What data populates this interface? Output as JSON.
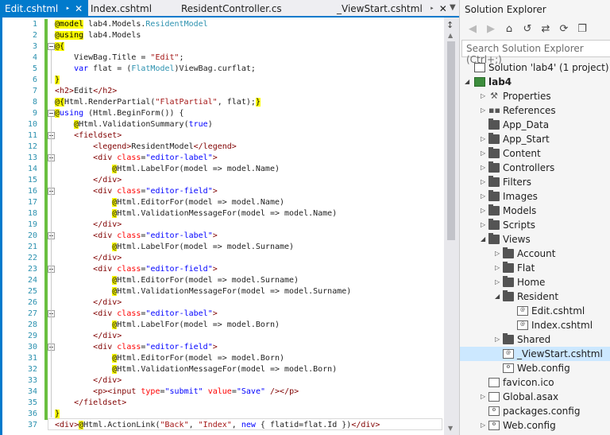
{
  "tabs": [
    {
      "label": "Edit.cshtml",
      "active": true,
      "pin": "‣",
      "close": "✕"
    },
    {
      "label": "Index.cshtml",
      "active": false
    },
    {
      "label": "ResidentController.cs",
      "active": false
    },
    {
      "label": "_ViewStart.cshtml",
      "active": false,
      "pin": "‣",
      "close": "✕"
    }
  ],
  "editor": {
    "line_numbers": [
      "1",
      "2",
      "3",
      "4",
      "5",
      "6",
      "7",
      "8",
      "9",
      "10",
      "11",
      "12",
      "13",
      "14",
      "15",
      "16",
      "17",
      "18",
      "19",
      "20",
      "21",
      "22",
      "23",
      "24",
      "25",
      "26",
      "27",
      "28",
      "29",
      "30",
      "31",
      "32",
      "33",
      "34",
      "35",
      "36",
      "37"
    ],
    "lines": [
      [
        {
          "t": "@model",
          "c": "rz"
        },
        {
          "t": " lab4.Models.",
          "c": ""
        },
        {
          "t": "ResidentModel",
          "c": "tp"
        }
      ],
      [
        {
          "t": "@using",
          "c": "rz"
        },
        {
          "t": " lab4.Models",
          "c": ""
        }
      ],
      [
        {
          "t": "@{",
          "c": "rz"
        }
      ],
      [
        {
          "t": "    ViewBag.Title = ",
          "c": ""
        },
        {
          "t": "\"Edit\"",
          "c": "st"
        },
        {
          "t": ";",
          "c": ""
        }
      ],
      [
        {
          "t": "    ",
          "c": ""
        },
        {
          "t": "var",
          "c": "kw"
        },
        {
          "t": " flat = (",
          "c": ""
        },
        {
          "t": "FlatModel",
          "c": "tp"
        },
        {
          "t": ")ViewBag.curflat;",
          "c": ""
        }
      ],
      [
        {
          "t": "}",
          "c": "rz"
        }
      ],
      [
        {
          "t": "<h2>",
          "c": "tg"
        },
        {
          "t": "Edit",
          "c": ""
        },
        {
          "t": "</h2>",
          "c": "tg"
        }
      ],
      [
        {
          "t": "@{",
          "c": "rz"
        },
        {
          "t": "Html.RenderPartial(",
          "c": ""
        },
        {
          "t": "\"FlatPartial\"",
          "c": "st"
        },
        {
          "t": ", flat);",
          "c": ""
        },
        {
          "t": "}",
          "c": "rz"
        }
      ],
      [
        {
          "t": "@",
          "c": "rz"
        },
        {
          "t": "using",
          "c": "kw"
        },
        {
          "t": " (Html.BeginForm()) {",
          "c": ""
        }
      ],
      [
        {
          "t": "    ",
          "c": ""
        },
        {
          "t": "@",
          "c": "rz"
        },
        {
          "t": "Html.ValidationSummary(",
          "c": ""
        },
        {
          "t": "true",
          "c": "kw"
        },
        {
          "t": ")",
          "c": ""
        }
      ],
      [
        {
          "t": "    ",
          "c": ""
        },
        {
          "t": "<fieldset>",
          "c": "tg"
        }
      ],
      [
        {
          "t": "        ",
          "c": ""
        },
        {
          "t": "<legend>",
          "c": "tg"
        },
        {
          "t": "ResidentModel",
          "c": ""
        },
        {
          "t": "</legend>",
          "c": "tg"
        }
      ],
      [
        {
          "t": "        ",
          "c": ""
        },
        {
          "t": "<div ",
          "c": "tg"
        },
        {
          "t": "class",
          "c": "at"
        },
        {
          "t": "=",
          "c": ""
        },
        {
          "t": "\"editor-label\"",
          "c": "av"
        },
        {
          "t": ">",
          "c": "tg"
        }
      ],
      [
        {
          "t": "            ",
          "c": ""
        },
        {
          "t": "@",
          "c": "rz"
        },
        {
          "t": "Html.LabelFor(model => model.Name)",
          "c": ""
        }
      ],
      [
        {
          "t": "        ",
          "c": ""
        },
        {
          "t": "</div>",
          "c": "tg"
        }
      ],
      [
        {
          "t": "        ",
          "c": ""
        },
        {
          "t": "<div ",
          "c": "tg"
        },
        {
          "t": "class",
          "c": "at"
        },
        {
          "t": "=",
          "c": ""
        },
        {
          "t": "\"editor-field\"",
          "c": "av"
        },
        {
          "t": ">",
          "c": "tg"
        }
      ],
      [
        {
          "t": "            ",
          "c": ""
        },
        {
          "t": "@",
          "c": "rz"
        },
        {
          "t": "Html.EditorFor(model => model.Name)",
          "c": ""
        }
      ],
      [
        {
          "t": "            ",
          "c": ""
        },
        {
          "t": "@",
          "c": "rz"
        },
        {
          "t": "Html.ValidationMessageFor(model => model.Name)",
          "c": ""
        }
      ],
      [
        {
          "t": "        ",
          "c": ""
        },
        {
          "t": "</div>",
          "c": "tg"
        }
      ],
      [
        {
          "t": "        ",
          "c": ""
        },
        {
          "t": "<div ",
          "c": "tg"
        },
        {
          "t": "class",
          "c": "at"
        },
        {
          "t": "=",
          "c": ""
        },
        {
          "t": "\"editor-label\"",
          "c": "av"
        },
        {
          "t": ">",
          "c": "tg"
        }
      ],
      [
        {
          "t": "            ",
          "c": ""
        },
        {
          "t": "@",
          "c": "rz"
        },
        {
          "t": "Html.LabelFor(model => model.Surname)",
          "c": ""
        }
      ],
      [
        {
          "t": "        ",
          "c": ""
        },
        {
          "t": "</div>",
          "c": "tg"
        }
      ],
      [
        {
          "t": "        ",
          "c": ""
        },
        {
          "t": "<div ",
          "c": "tg"
        },
        {
          "t": "class",
          "c": "at"
        },
        {
          "t": "=",
          "c": ""
        },
        {
          "t": "\"editor-field\"",
          "c": "av"
        },
        {
          "t": ">",
          "c": "tg"
        }
      ],
      [
        {
          "t": "            ",
          "c": ""
        },
        {
          "t": "@",
          "c": "rz"
        },
        {
          "t": "Html.EditorFor(model => model.Surname)",
          "c": ""
        }
      ],
      [
        {
          "t": "            ",
          "c": ""
        },
        {
          "t": "@",
          "c": "rz"
        },
        {
          "t": "Html.ValidationMessageFor(model => model.Surname)",
          "c": ""
        }
      ],
      [
        {
          "t": "        ",
          "c": ""
        },
        {
          "t": "</div>",
          "c": "tg"
        }
      ],
      [
        {
          "t": "        ",
          "c": ""
        },
        {
          "t": "<div ",
          "c": "tg"
        },
        {
          "t": "class",
          "c": "at"
        },
        {
          "t": "=",
          "c": ""
        },
        {
          "t": "\"editor-label\"",
          "c": "av"
        },
        {
          "t": ">",
          "c": "tg"
        }
      ],
      [
        {
          "t": "            ",
          "c": ""
        },
        {
          "t": "@",
          "c": "rz"
        },
        {
          "t": "Html.LabelFor(model => model.Born)",
          "c": ""
        }
      ],
      [
        {
          "t": "        ",
          "c": ""
        },
        {
          "t": "</div>",
          "c": "tg"
        }
      ],
      [
        {
          "t": "        ",
          "c": ""
        },
        {
          "t": "<div ",
          "c": "tg"
        },
        {
          "t": "class",
          "c": "at"
        },
        {
          "t": "=",
          "c": ""
        },
        {
          "t": "\"editor-field\"",
          "c": "av"
        },
        {
          "t": ">",
          "c": "tg"
        }
      ],
      [
        {
          "t": "            ",
          "c": ""
        },
        {
          "t": "@",
          "c": "rz"
        },
        {
          "t": "Html.EditorFor(model => model.Born)",
          "c": ""
        }
      ],
      [
        {
          "t": "            ",
          "c": ""
        },
        {
          "t": "@",
          "c": "rz"
        },
        {
          "t": "Html.ValidationMessageFor(model => model.Born)",
          "c": ""
        }
      ],
      [
        {
          "t": "        ",
          "c": ""
        },
        {
          "t": "</div>",
          "c": "tg"
        }
      ],
      [
        {
          "t": "        ",
          "c": ""
        },
        {
          "t": "<p><input ",
          "c": "tg"
        },
        {
          "t": "type",
          "c": "at"
        },
        {
          "t": "=",
          "c": ""
        },
        {
          "t": "\"submit\"",
          "c": "av"
        },
        {
          "t": " ",
          "c": ""
        },
        {
          "t": "value",
          "c": "at"
        },
        {
          "t": "=",
          "c": ""
        },
        {
          "t": "\"Save\"",
          "c": "av"
        },
        {
          "t": " /></p>",
          "c": "tg"
        }
      ],
      [
        {
          "t": "    ",
          "c": ""
        },
        {
          "t": "</fieldset>",
          "c": "tg"
        }
      ],
      [
        {
          "t": "}",
          "c": "rz"
        }
      ],
      [
        {
          "t": "<div>",
          "c": "tg"
        },
        {
          "t": "@",
          "c": "rz"
        },
        {
          "t": "Html.ActionLink(",
          "c": ""
        },
        {
          "t": "\"Back\"",
          "c": "st"
        },
        {
          "t": ", ",
          "c": ""
        },
        {
          "t": "\"Index\"",
          "c": "st"
        },
        {
          "t": ", ",
          "c": ""
        },
        {
          "t": "new",
          "c": "kw"
        },
        {
          "t": " { flatid=flat.Id }",
          "c": ""
        },
        {
          "t": ")",
          "c": ""
        },
        {
          "t": "</div>",
          "c": "tg"
        }
      ]
    ]
  },
  "scrollbar": {
    "split_icon": "↕",
    "up_icon": "▲",
    "down_icon": "▼"
  },
  "solution_explorer": {
    "title": "Solution Explorer",
    "toolbar_icons": [
      "◀",
      "▶",
      "⌂",
      "↺",
      "⇄",
      "⟳",
      "❐"
    ],
    "search_placeholder": "Search Solution Explorer (Ctrl+;)",
    "tree": [
      {
        "label": "Solution 'lab4' (1 project)",
        "level": 0,
        "arrow": "",
        "icon": "solution"
      },
      {
        "label": "lab4",
        "level": 0,
        "arrow": "◢",
        "icon": "project",
        "bold": true
      },
      {
        "label": "Properties",
        "level": 1,
        "arrow": "▷",
        "icon": "props"
      },
      {
        "label": "References",
        "level": 1,
        "arrow": "▷",
        "icon": "refs"
      },
      {
        "label": "App_Data",
        "level": 1,
        "arrow": "",
        "icon": "folder"
      },
      {
        "label": "App_Start",
        "level": 1,
        "arrow": "▷",
        "icon": "folder"
      },
      {
        "label": "Content",
        "level": 1,
        "arrow": "▷",
        "icon": "folder"
      },
      {
        "label": "Controllers",
        "level": 1,
        "arrow": "▷",
        "icon": "folder"
      },
      {
        "label": "Filters",
        "level": 1,
        "arrow": "▷",
        "icon": "folder"
      },
      {
        "label": "Images",
        "level": 1,
        "arrow": "▷",
        "icon": "folder"
      },
      {
        "label": "Models",
        "level": 1,
        "arrow": "▷",
        "icon": "folder"
      },
      {
        "label": "Scripts",
        "level": 1,
        "arrow": "▷",
        "icon": "folder"
      },
      {
        "label": "Views",
        "level": 1,
        "arrow": "◢",
        "icon": "folder"
      },
      {
        "label": "Account",
        "level": 2,
        "arrow": "▷",
        "icon": "folder"
      },
      {
        "label": "Flat",
        "level": 2,
        "arrow": "▷",
        "icon": "folder"
      },
      {
        "label": "Home",
        "level": 2,
        "arrow": "▷",
        "icon": "folder"
      },
      {
        "label": "Resident",
        "level": 2,
        "arrow": "◢",
        "icon": "folder"
      },
      {
        "label": "Edit.cshtml",
        "level": 3,
        "arrow": "",
        "icon": "cshtml"
      },
      {
        "label": "Index.cshtml",
        "level": 3,
        "arrow": "",
        "icon": "cshtml"
      },
      {
        "label": "Shared",
        "level": 2,
        "arrow": "▷",
        "icon": "folder"
      },
      {
        "label": "_ViewStart.cshtml",
        "level": 2,
        "arrow": "",
        "icon": "cshtml",
        "selected": true
      },
      {
        "label": "Web.config",
        "level": 2,
        "arrow": "",
        "icon": "config"
      },
      {
        "label": "favicon.ico",
        "level": 1,
        "arrow": "",
        "icon": "file"
      },
      {
        "label": "Global.asax",
        "level": 1,
        "arrow": "▷",
        "icon": "file"
      },
      {
        "label": "packages.config",
        "level": 1,
        "arrow": "",
        "icon": "config"
      },
      {
        "label": "Web.config",
        "level": 1,
        "arrow": "▷",
        "icon": "config"
      }
    ]
  }
}
